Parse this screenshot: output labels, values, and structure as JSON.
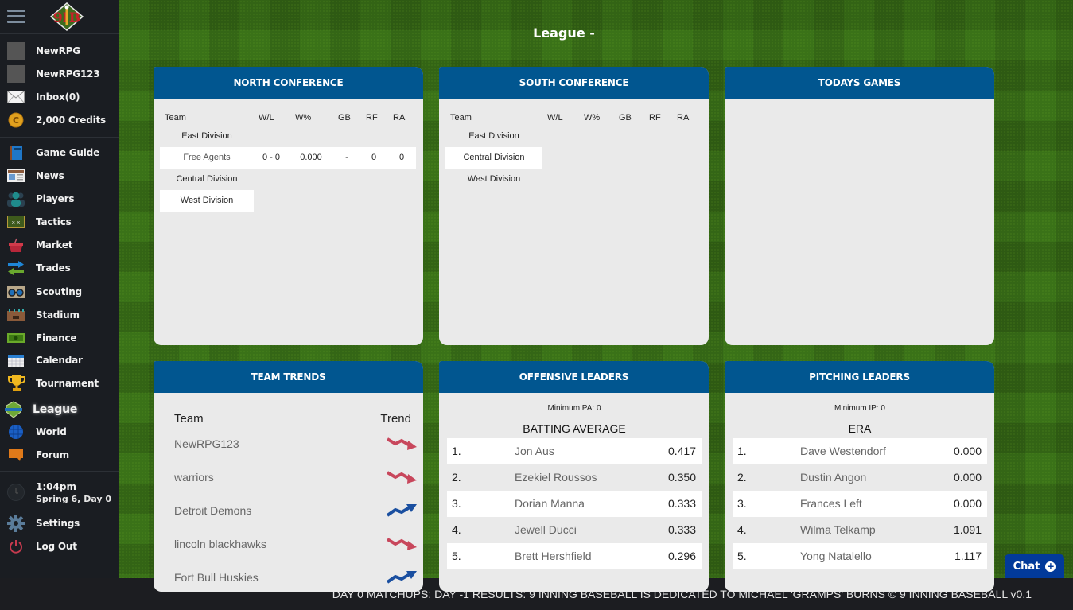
{
  "sidebar": {
    "account": [
      {
        "label": "NewRPG",
        "icon": "avatar-icon"
      },
      {
        "label": "NewRPG123",
        "icon": "team-logo-icon"
      },
      {
        "label": "Inbox(0)",
        "icon": "mail-icon"
      },
      {
        "label": "2,000 Credits",
        "icon": "coin-icon"
      }
    ],
    "nav": [
      {
        "label": "Game Guide",
        "icon": "book-icon"
      },
      {
        "label": "News",
        "icon": "newspaper-icon"
      },
      {
        "label": "Players",
        "icon": "players-icon"
      },
      {
        "label": "Tactics",
        "icon": "chalkboard-icon"
      },
      {
        "label": "Market",
        "icon": "basket-icon"
      },
      {
        "label": "Trades",
        "icon": "swap-arrows-icon"
      },
      {
        "label": "Scouting",
        "icon": "binoculars-icon"
      },
      {
        "label": "Stadium",
        "icon": "stadium-icon"
      },
      {
        "label": "Finance",
        "icon": "money-icon"
      },
      {
        "label": "Calendar",
        "icon": "calendar-icon"
      },
      {
        "label": "Tournament",
        "icon": "trophy-icon"
      },
      {
        "label": "League",
        "icon": "league-shield-icon",
        "active": true
      },
      {
        "label": "World",
        "icon": "globe-icon"
      },
      {
        "label": "Forum",
        "icon": "speech-bubble-icon"
      }
    ],
    "time": "1:04pm",
    "date": "Spring 6, Day 0",
    "settings_label": "Settings",
    "logout_label": "Log Out"
  },
  "page_title": "League -",
  "north": {
    "title": "NORTH CONFERENCE",
    "headers": {
      "team": "Team",
      "wl": "W/L",
      "wp": "W%",
      "gb": "GB",
      "rf": "RF",
      "ra": "RA"
    },
    "divisions": [
      "East Division",
      "Central Division",
      "West Division"
    ],
    "teams": [
      {
        "name": "Free Agents",
        "wl": "0 - 0",
        "wp": "0.000",
        "gb": "-",
        "rf": "0",
        "ra": "0"
      }
    ]
  },
  "south": {
    "title": "SOUTH CONFERENCE",
    "headers": {
      "team": "Team",
      "wl": "W/L",
      "wp": "W%",
      "gb": "GB",
      "rf": "RF",
      "ra": "RA"
    },
    "divisions": [
      "East Division",
      "Central Division",
      "West Division"
    ]
  },
  "todays_games": {
    "title": "TODAYS GAMES"
  },
  "trends": {
    "title": "TEAM TRENDS",
    "header_team": "Team",
    "header_trend": "Trend",
    "rows": [
      {
        "team": "NewRPG123",
        "trend": "down"
      },
      {
        "team": "warriors",
        "trend": "down"
      },
      {
        "team": "Detroit Demons",
        "trend": "up"
      },
      {
        "team": "lincoln blackhawks",
        "trend": "down"
      },
      {
        "team": "Fort Bull Huskies",
        "trend": "up"
      }
    ],
    "colors": {
      "up": "#1a4fa0",
      "down": "#c8475c"
    }
  },
  "offense": {
    "title": "OFFENSIVE LEADERS",
    "minimum": "Minimum PA: 0",
    "stat": "BATTING AVERAGE",
    "rows": [
      {
        "rank": "1.",
        "name": "Jon Aus",
        "value": "0.417"
      },
      {
        "rank": "2.",
        "name": "Ezekiel Roussos",
        "value": "0.350"
      },
      {
        "rank": "3.",
        "name": "Dorian Manna",
        "value": "0.333"
      },
      {
        "rank": "4.",
        "name": "Jewell Ducci",
        "value": "0.333"
      },
      {
        "rank": "5.",
        "name": "Brett Hershfield",
        "value": "0.296"
      }
    ]
  },
  "pitching": {
    "title": "PITCHING LEADERS",
    "minimum": "Minimum IP: 0",
    "stat": "ERA",
    "rows": [
      {
        "rank": "1.",
        "name": "Dave Westendorf",
        "value": "0.000"
      },
      {
        "rank": "2.",
        "name": "Dustin Angon",
        "value": "0.000"
      },
      {
        "rank": "3.",
        "name": "Frances Left",
        "value": "0.000"
      },
      {
        "rank": "4.",
        "name": "Wilma Telkamp",
        "value": "1.091"
      },
      {
        "rank": "5.",
        "name": "Yong Natalello",
        "value": "1.117"
      }
    ]
  },
  "ticker": "DAY 0 MATCHUPS: DAY -1 RESULTS: 9 INNING BASEBALL IS DEDICATED TO MICHAEL 'GRAMPS' BURNS © 9 INNING BASEBALL v0.1",
  "chat_label": "Chat",
  "colors": {
    "panel_header": "#015690",
    "panel_body": "#eaeaea",
    "sidebar": "#1a1d22",
    "chat": "#023a9a"
  }
}
